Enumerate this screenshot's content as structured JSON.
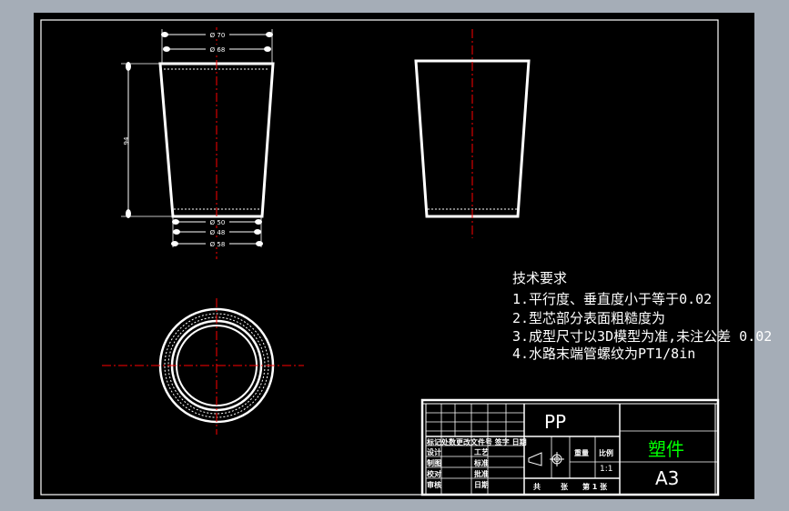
{
  "notes": {
    "title": "技术要求",
    "lines": [
      "1.平行度、垂直度小于等于0.02",
      "2.型芯部分表面粗糙度为",
      "3.成型尺寸以3D模型为准,未注公差 0.02",
      "4.水路末端管螺纹为PT1/8in"
    ]
  },
  "dims": {
    "top1": "Ø 70",
    "top2": "Ø 68",
    "height": "94",
    "bot1": "Ø 50",
    "bot2": "Ø 48",
    "bot3": "Ø 58"
  },
  "title_block": {
    "material": "PP",
    "part_name": "塑件",
    "sheet_size": "A3",
    "scale": "1:1",
    "weight_label": "重量",
    "scale_label": "比例",
    "header_row": "标记处数更改文件号  签字  日期",
    "rows": [
      {
        "a": "设计",
        "b": "工艺"
      },
      {
        "a": "制图",
        "b": "标准"
      },
      {
        "a": "校对",
        "b": "批准"
      },
      {
        "a": "审核",
        "b": "日期"
      }
    ],
    "sheets_total": "共",
    "sheets_unit1": "张",
    "sheet_no": "第 1 张"
  },
  "colors": {
    "background": "#a5adb7",
    "paper": "#000000",
    "line": "#ffffff",
    "centerline": "#ff0000",
    "part_name": "#00ff00"
  }
}
